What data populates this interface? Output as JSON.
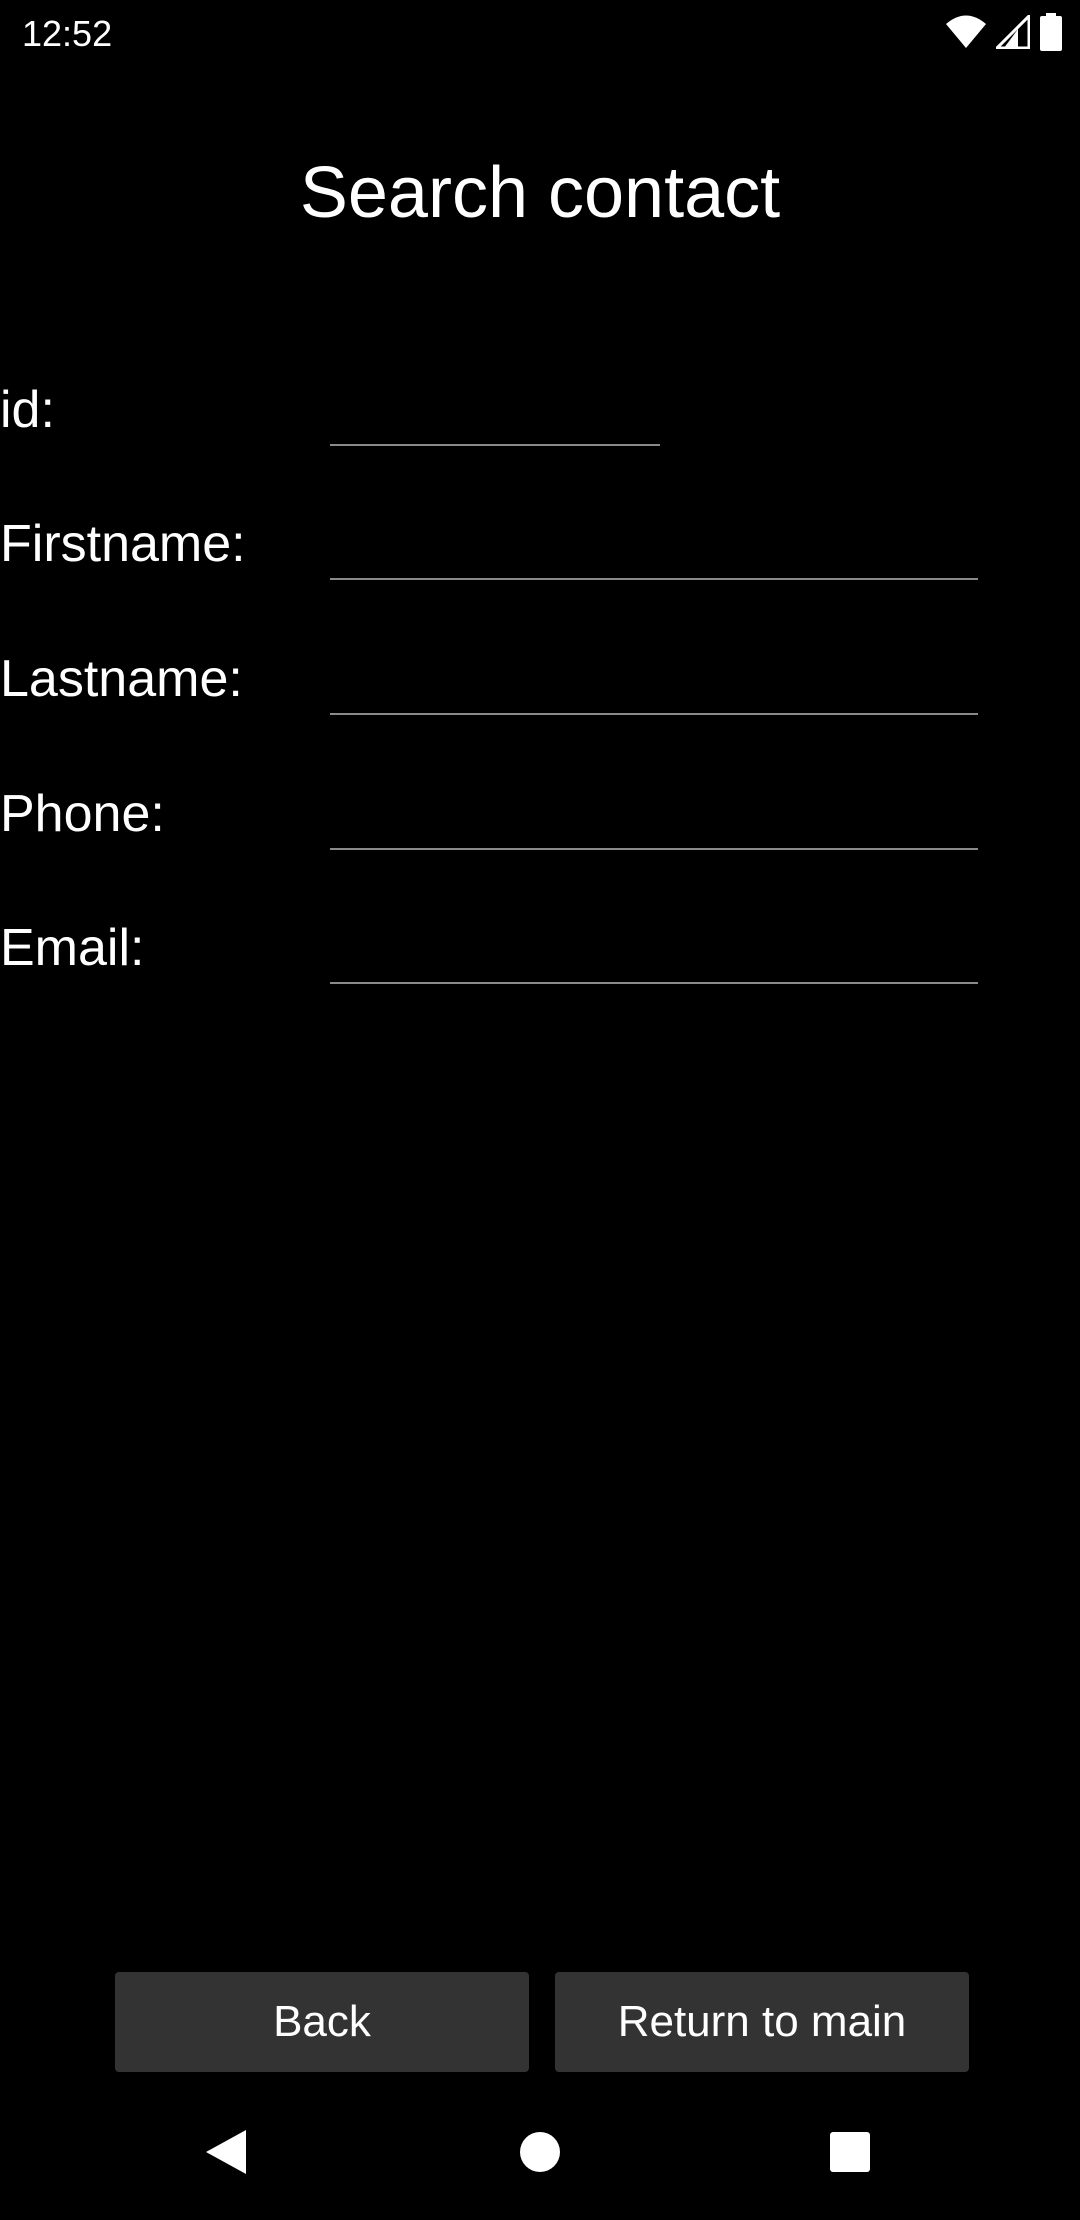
{
  "status_bar": {
    "time": "12:52",
    "icons": [
      "wifi-icon",
      "cell-signal-icon",
      "battery-icon"
    ]
  },
  "page": {
    "title": "Search contact"
  },
  "form": {
    "fields": [
      {
        "label": "id:",
        "value": "",
        "placeholder": ""
      },
      {
        "label": "Firstname:",
        "value": "",
        "placeholder": ""
      },
      {
        "label": "Lastname:",
        "value": "",
        "placeholder": ""
      },
      {
        "label": "Phone:",
        "value": "",
        "placeholder": ""
      },
      {
        "label": "Email:",
        "value": "",
        "placeholder": ""
      }
    ]
  },
  "buttons": {
    "back_label": "Back",
    "return_label": "Return to main"
  },
  "nav_bar": {
    "icons": [
      "back-triangle-icon",
      "home-circle-icon",
      "recents-square-icon"
    ]
  },
  "colors": {
    "background": "#000000",
    "text": "#ffffff",
    "button_bg": "#333333",
    "input_underline": "#8a8a8a"
  }
}
